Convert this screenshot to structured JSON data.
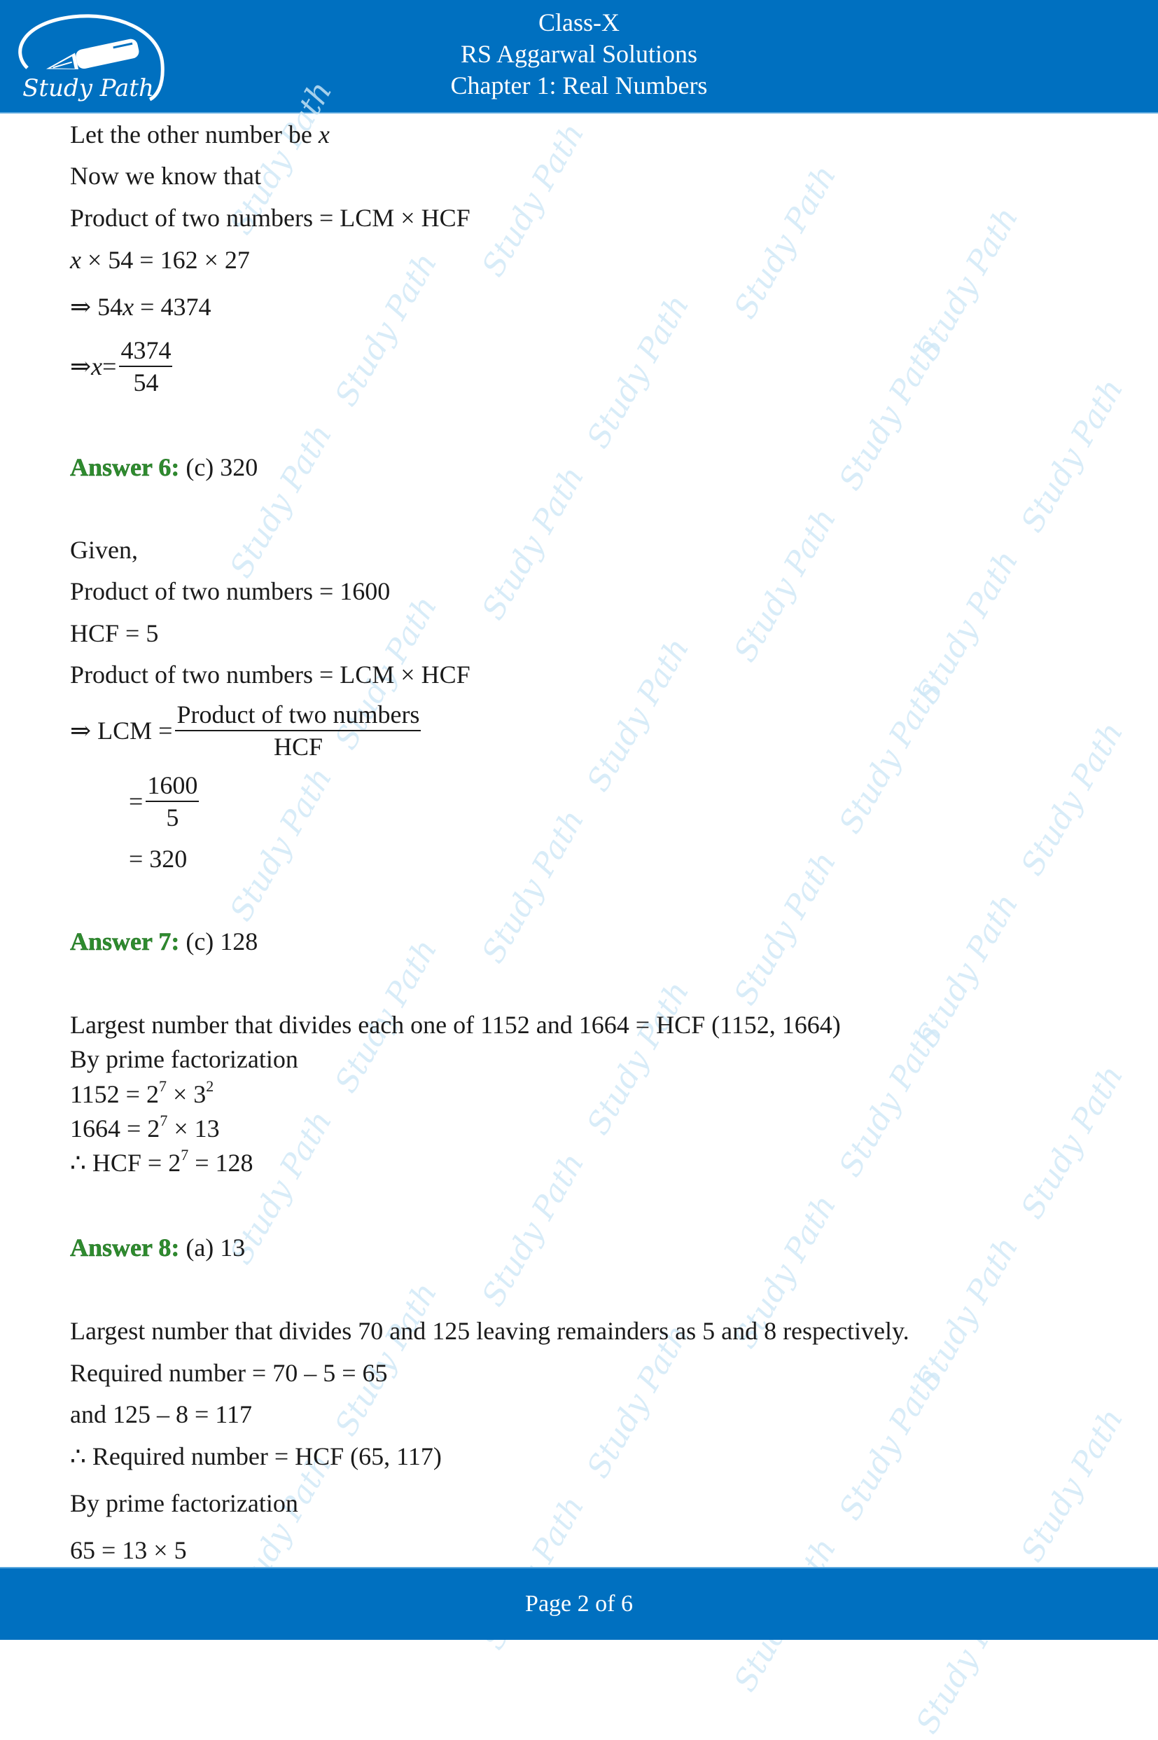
{
  "header": {
    "logo_text": "Study Path",
    "title_lines": [
      "Class-X",
      "RS Aggarwal Solutions",
      "Chapter 1: Real Numbers"
    ]
  },
  "watermark_text": "Study Path",
  "content": {
    "q5_cont": {
      "l1": "Let the other number be ",
      "l1_var": "x",
      "l2": "Now we know that",
      "l3": "Product of two numbers = LCM × HCF",
      "l4_var": "x",
      "l4": " × 54 = 162 × 27",
      "l5_pre": "⇒ 54",
      "l5_var": "x",
      "l5_post": " = 4374",
      "l6_pre": "⇒ ",
      "l6_var": "x",
      "l6_eq": " =",
      "l6_num": "4374",
      "l6_den": "54"
    },
    "answer6": {
      "label": "Answer 6:",
      "value": " (c) 320",
      "lines": [
        "Given,",
        "Product of two numbers = 1600",
        "HCF = 5",
        "Product of two numbers = LCM × HCF"
      ],
      "frac1_pre": "⇒ LCM =",
      "frac1_num": "Product of two numbers",
      "frac1_den": "HCF",
      "frac2_pre": "=",
      "frac2_num": "1600",
      "frac2_den": "5",
      "result": "= 320"
    },
    "answer7": {
      "label": "Answer 7:",
      "value": " (c) 128",
      "l1": "Largest number that divides each one of 1152 and 1664 = HCF (1152, 1664)",
      "l2": "By prime factorization",
      "l3": {
        "lhs": "1152 = 2",
        "exp1": "7",
        "mid": " × 3",
        "exp2": "2"
      },
      "l4": {
        "lhs": "1664 = 2",
        "exp1": "7",
        "rest": " × 13"
      },
      "l5": {
        "lhs": "∴ HCF = 2",
        "exp1": "7",
        "rest": " = 128"
      }
    },
    "answer8": {
      "label": "Answer 8:",
      "value": " (a) 13",
      "lines": [
        "Largest number that divides 70 and 125 leaving remainders as 5 and 8 respectively.",
        "Required number = 70 – 5 = 65",
        "and 125 – 8 = 117",
        "∴ Required number = HCF (65, 117)",
        "By prime factorization",
        "65 = 13 × 5"
      ]
    }
  },
  "footer": {
    "page_label": "Page 2 of 6",
    "current_page": 2,
    "total_pages": 6
  },
  "colors": {
    "brand_blue": "#0070c0",
    "answer_green": "#2e8b2e",
    "watermark": "#cfe8f7"
  }
}
